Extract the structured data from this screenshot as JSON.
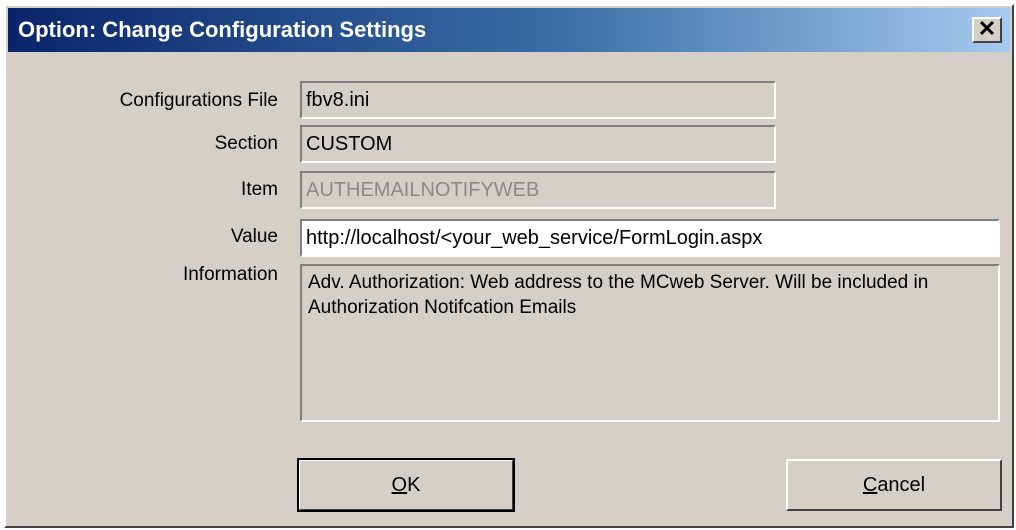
{
  "window": {
    "title": "Option: Change Configuration Settings",
    "close_glyph": "✕"
  },
  "form": {
    "config_file": {
      "label": "Configurations File",
      "value": "fbv8.ini"
    },
    "section": {
      "label": "Section",
      "value": "CUSTOM"
    },
    "item": {
      "label": "Item",
      "value": "AUTHEMAILNOTIFYWEB"
    },
    "value": {
      "label": "Value",
      "value": "http://localhost/<your_web_service/FormLogin.aspx"
    },
    "information": {
      "label": "Information",
      "value": "Adv. Authorization: Web address to the MCweb Server. Will be included in Authorization Notifcation Emails"
    }
  },
  "buttons": {
    "ok": {
      "mnemonic": "O",
      "rest": "K"
    },
    "cancel": {
      "mnemonic": "C",
      "rest": "ancel"
    }
  }
}
